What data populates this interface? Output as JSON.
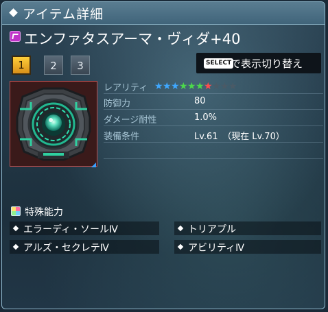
{
  "header": {
    "title": "アイテム詳細"
  },
  "item": {
    "name": "エンファタスアーマ・ヴィダ+40"
  },
  "tabs": [
    {
      "label": "1",
      "active": true
    },
    {
      "label": "2",
      "active": false
    },
    {
      "label": "3",
      "active": false
    }
  ],
  "select_hint": {
    "key": "SELECT",
    "text": "で表示切り替え"
  },
  "stats": {
    "rarity_label": "レアリティ",
    "rarity": {
      "stars": [
        {
          "glyph": "★",
          "color": "#3fa8ff"
        },
        {
          "glyph": "★",
          "color": "#3fa8ff"
        },
        {
          "glyph": "★",
          "color": "#3fa8ff"
        },
        {
          "glyph": "★",
          "color": "#4cd94c"
        },
        {
          "glyph": "★",
          "color": "#4cd94c"
        },
        {
          "glyph": "★",
          "color": "#4cd94c"
        },
        {
          "glyph": "★",
          "color": "#ff4d4d"
        },
        {
          "glyph": "★",
          "color": "#4a5a66"
        },
        {
          "glyph": "★",
          "color": "#4a5a66"
        },
        {
          "glyph": "★",
          "color": "#4a5a66"
        }
      ]
    },
    "defense_label": "防御力",
    "defense_value": "80",
    "damage_resist_label": "ダメージ耐性",
    "damage_resist_value": "1.0%",
    "requirement_label": "装備条件",
    "requirement_value": "Lv.61　（現在 Lv.70）"
  },
  "special": {
    "label": "特殊能力",
    "abilities": [
      "エラーディ・ソールⅣ",
      "トリアプル",
      "アルズ・セクレテⅣ",
      "アビリティⅣ"
    ]
  }
}
